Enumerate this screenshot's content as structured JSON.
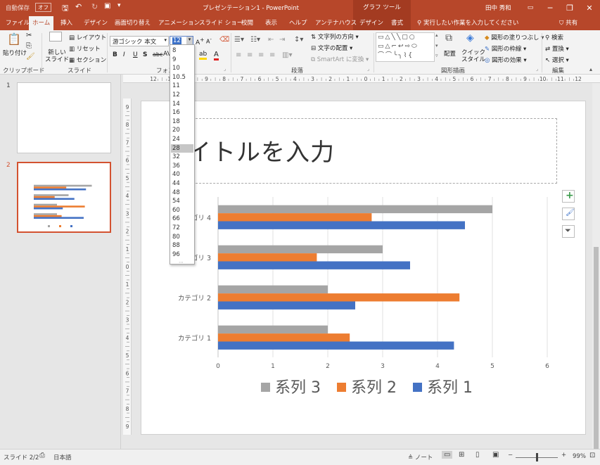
{
  "titlebar": {
    "autosave": "自動保存",
    "autosave_state": "オフ",
    "doc_title": "プレゼンテーション1 - PowerPoint",
    "context_tools": "グラフ ツール",
    "user": "田中 秀和"
  },
  "tabs": [
    "ファイル",
    "ホーム",
    "挿入",
    "デザイン",
    "画面切り替え",
    "アニメーション",
    "スライド ショー",
    "校閲",
    "表示",
    "ヘルプ",
    "アンテナハウス",
    "デザイン",
    "書式"
  ],
  "tell_me": "実行したい作業を入力してください",
  "share": "共有",
  "ribbon": {
    "paste": "貼り付け",
    "new_slide": "新しい\nスライド",
    "layout": "レイアウト",
    "reset": "リセット",
    "section": "セクション",
    "font_name": "游ゴシック 本文",
    "font_size": "12",
    "text_direction": "文字列の方向",
    "align_text": "文字の配置",
    "smartart": "SmartArt に変換",
    "arrange": "配置",
    "quick_styles": "クイック\nスタイル",
    "shape_fill": "図形の塗りつぶし",
    "shape_outline": "図形の枠線",
    "shape_effects": "図形の効果",
    "find": "検索",
    "replace": "置換",
    "select": "選択",
    "groups": {
      "clipboard": "クリップボード",
      "slides": "スライド",
      "font": "フォン",
      "paragraph": "段落",
      "drawing": "図形描画",
      "editing": "編集"
    }
  },
  "font_sizes": [
    "8",
    "9",
    "10",
    "10.5",
    "11",
    "12",
    "14",
    "16",
    "18",
    "20",
    "24",
    "28",
    "32",
    "36",
    "40",
    "44",
    "48",
    "54",
    "60",
    "66",
    "72",
    "80",
    "88",
    "96"
  ],
  "font_size_highlighted": "28",
  "ruler_h_labels": [
    "12",
    "11",
    "10",
    "9",
    "8",
    "7",
    "6",
    "5",
    "4",
    "3",
    "2",
    "1",
    "0",
    "1",
    "2",
    "3",
    "4",
    "5",
    "6",
    "7",
    "8",
    "9",
    "10",
    "11",
    "12"
  ],
  "ruler_v_labels": [
    "9",
    "8",
    "7",
    "6",
    "5",
    "4",
    "3",
    "2",
    "1",
    "0",
    "1",
    "2",
    "3",
    "4",
    "5",
    "6",
    "7",
    "8",
    "9"
  ],
  "thumbnails": [
    {
      "number": "1"
    },
    {
      "number": "2"
    }
  ],
  "slide": {
    "title_placeholder": "タイトルを入力"
  },
  "chart_data": {
    "type": "bar",
    "orientation": "horizontal",
    "categories": [
      "カテゴリ 1",
      "カテゴリ 2",
      "カテゴリ 3",
      "カテゴリ 4"
    ],
    "series": [
      {
        "name": "系列 1",
        "color": "#4472c4",
        "values": [
          4.3,
          2.5,
          3.5,
          4.5
        ]
      },
      {
        "name": "系列 2",
        "color": "#ed7d31",
        "values": [
          2.4,
          4.4,
          1.8,
          2.8
        ]
      },
      {
        "name": "系列 3",
        "color": "#a5a5a5",
        "values": [
          2.0,
          2.0,
          3.0,
          5.0
        ]
      }
    ],
    "xlim": [
      0,
      6
    ],
    "xticks": [
      "0",
      "1",
      "2",
      "3",
      "4",
      "5",
      "6"
    ],
    "legend_order": [
      "系列 3",
      "系列 2",
      "系列 1"
    ],
    "legend_position": "bottom",
    "grid": true
  },
  "statusbar": {
    "slide": "スライド 2/2",
    "language": "日本語",
    "notes": "ノート",
    "zoom": "99%"
  },
  "colors": {
    "accent": "#b7472a",
    "selection": "#d35230"
  }
}
